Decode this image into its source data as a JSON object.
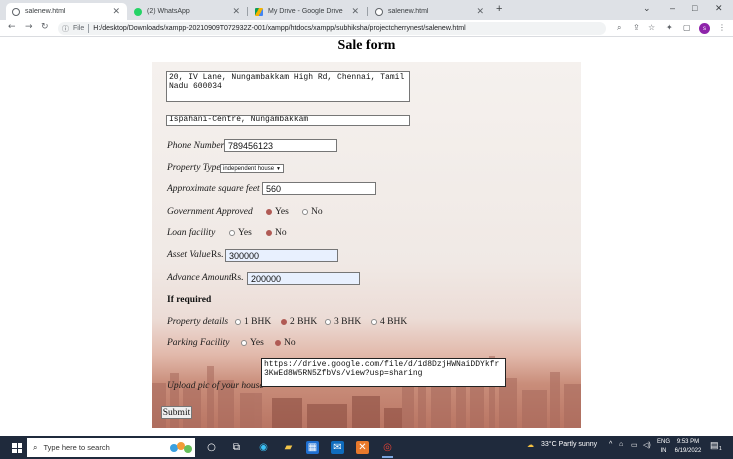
{
  "browser": {
    "tabs": [
      {
        "title": "salenew.html",
        "favicon_color": "#5f6368",
        "active": true
      },
      {
        "title": "(2) WhatsApp",
        "favicon_color": "#25d366",
        "active": false
      },
      {
        "title": "My Drive - Google Drive",
        "favicon_color": "#f4b400",
        "active": false
      },
      {
        "title": "salenew.html",
        "favicon_color": "#5f6368",
        "active": false
      }
    ],
    "new_tab_symbol": "+",
    "window_controls": {
      "collapse": "⌄",
      "minimize": "–",
      "maximize": "□",
      "close": "✕"
    },
    "url_scheme": "File",
    "url": "H:/desktop/Downloads/xampp-20210909T072932Z-001/xampp/htdocs/xampp/subhiksha/projectcherrynest/salenew.html",
    "profile_initial": "s"
  },
  "page": {
    "title": "Sale form",
    "address_value": "20, IV Lane, Nungambakkam High Rd, Chennai, Tamil Nadu 600034",
    "landmark_value": "Ispahani-Centre, Nungambakkam",
    "phone": {
      "label": "Phone Number",
      "value": "789456123"
    },
    "property_type": {
      "label": "Property Type",
      "selected": "independent house"
    },
    "sqft": {
      "label": "Approximate square feet",
      "value": "560"
    },
    "govt_approved": {
      "label": "Government Approved",
      "options": [
        "Yes",
        "No"
      ],
      "selected": "Yes"
    },
    "loan": {
      "label": "Loan facility",
      "options": [
        "Yes",
        "No"
      ],
      "selected": "No"
    },
    "asset": {
      "label": "Asset Value",
      "unit": "Rs.",
      "value": "300000"
    },
    "advance": {
      "label": "Advance Amount",
      "unit": "Rs.",
      "value": "200000"
    },
    "if_required": "If required",
    "property_details": {
      "label": "Property details",
      "options": [
        "1 BHK",
        "2 BHK",
        "3 BHK",
        "4 BHK"
      ],
      "selected": "2 BHK"
    },
    "parking": {
      "label": "Parking Facility",
      "options": [
        "Yes",
        "No"
      ],
      "selected": "No"
    },
    "upload": {
      "label": "Upload pic of your house",
      "value": "https://drive.google.com/file/d/1d8DzjHWNaiDDYkfr3KwEd8W5RN5ZfbVs/view?usp=sharing"
    },
    "submit_label": "Submit"
  },
  "taskbar": {
    "search_placeholder": "Type here to search",
    "weather": "33°C  Partly sunny",
    "lang_line1": "ENG",
    "lang_line2": "IN",
    "time": "9:53 PM",
    "date": "6/19/2022",
    "notification_count": "1"
  },
  "colors": {
    "radio_checked": "#b05a54",
    "taskbar": "#1f2a3c",
    "autofill": "#e8f0fe"
  }
}
